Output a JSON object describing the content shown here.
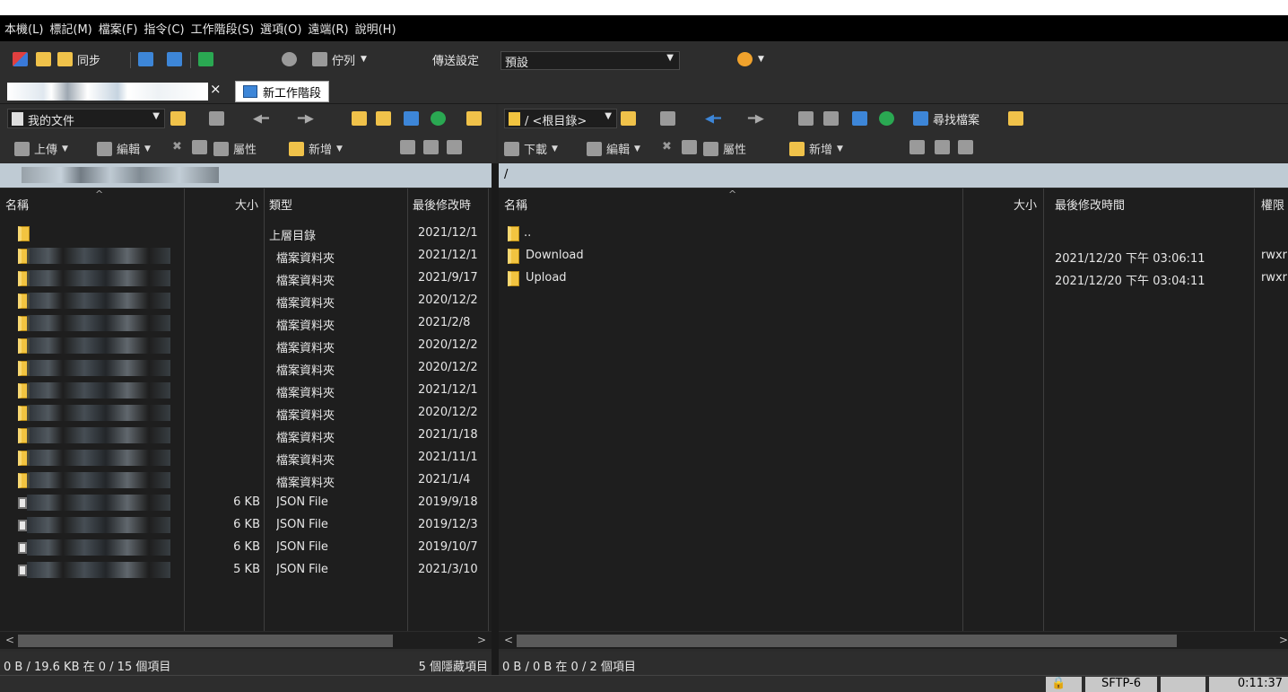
{
  "menu": [
    "本機(L)",
    "標記(M)",
    "檔案(F)",
    "指令(C)",
    "工作階段(S)",
    "選項(O)",
    "遠端(R)",
    "說明(H)"
  ],
  "toolbar": {
    "sync_label": "同步",
    "queue_label": "佇列",
    "transfer_settings_label": "傳送設定",
    "transfer_preset": "預設"
  },
  "tabs": {
    "close_glyph": "×",
    "new_session": "新工作階段"
  },
  "local": {
    "location": "我的文件",
    "actions": {
      "upload": "上傳",
      "edit": "編輯",
      "properties": "屬性",
      "new": "新增"
    },
    "columns": {
      "name": "名稱",
      "size": "大小",
      "type": "類型",
      "modified": "最後修改時"
    },
    "rows": [
      {
        "size": "",
        "type": "上層目錄",
        "modified": "2021/12/1"
      },
      {
        "size": "",
        "type": "檔案資料夾",
        "modified": "2021/12/1"
      },
      {
        "size": "",
        "type": "檔案資料夾",
        "modified": "2021/9/17"
      },
      {
        "size": "",
        "type": "檔案資料夾",
        "modified": "2020/12/2"
      },
      {
        "size": "",
        "type": "檔案資料夾",
        "modified": "2021/2/8"
      },
      {
        "size": "",
        "type": "檔案資料夾",
        "modified": "2020/12/2"
      },
      {
        "size": "",
        "type": "檔案資料夾",
        "modified": "2020/12/2"
      },
      {
        "size": "",
        "type": "檔案資料夾",
        "modified": "2021/12/1"
      },
      {
        "size": "",
        "type": "檔案資料夾",
        "modified": "2020/12/2"
      },
      {
        "size": "",
        "type": "檔案資料夾",
        "modified": "2021/1/18"
      },
      {
        "size": "",
        "type": "檔案資料夾",
        "modified": "2021/11/1"
      },
      {
        "size": "",
        "type": "檔案資料夾",
        "modified": "2021/1/4"
      },
      {
        "size": "6 KB",
        "type": "JSON File",
        "modified": "2019/9/18"
      },
      {
        "size": "6 KB",
        "type": "JSON File",
        "modified": "2019/12/3"
      },
      {
        "size": "6 KB",
        "type": "JSON File",
        "modified": "2019/10/7"
      },
      {
        "size": "5 KB",
        "type": "JSON File",
        "modified": "2021/3/10"
      }
    ],
    "status": "0 B / 19.6 KB 在 0 / 15 個項目",
    "hidden": "5 個隱藏項目"
  },
  "remote": {
    "location": "/ <根目錄>",
    "find_files": "尋找檔案",
    "actions": {
      "download": "下載",
      "edit": "編輯",
      "properties": "屬性",
      "new": "新增"
    },
    "current_path": "/",
    "columns": {
      "name": "名稱",
      "size": "大小",
      "modified": "最後修改時間",
      "rights": "權限"
    },
    "rows": [
      {
        "name": "..",
        "modified": "",
        "rights": ""
      },
      {
        "name": "Download",
        "modified": "2021/12/20 下午 03:06:11",
        "rights": "rwxr"
      },
      {
        "name": "Upload",
        "modified": "2021/12/20 下午 03:04:11",
        "rights": "rwxr"
      }
    ],
    "status": "0 B / 0 B 在 0 / 2 個項目"
  },
  "bottom": {
    "protocol": "SFTP-6",
    "elapsed": "0:11:37"
  },
  "colors": {
    "menubar": "#000000",
    "pane": "#1e1e1e",
    "path_bar": "#bfcbd4",
    "folder": "#f2c440"
  }
}
